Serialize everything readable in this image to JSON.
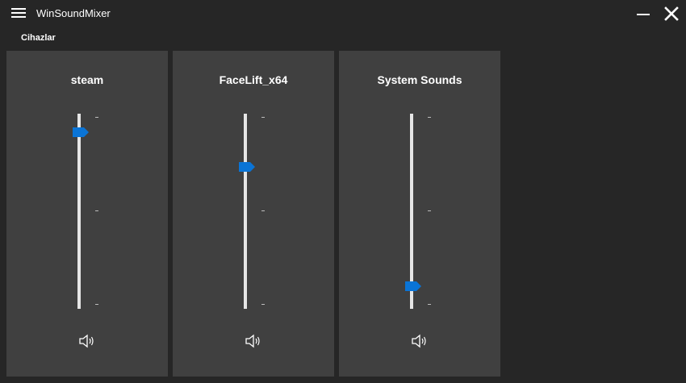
{
  "app": {
    "title": "WinSoundMixer",
    "devices_label": "Cihazlar"
  },
  "colors": {
    "window_bg": "#262626",
    "panel_bg": "#404040",
    "accent": "#0a74d6",
    "track": "#e6e6e6"
  },
  "icons": {
    "menu": "hamburger-menu-icon",
    "minimize": "minimize-icon",
    "close": "close-icon",
    "speaker": "speaker-icon"
  },
  "channels": [
    {
      "name": "steam",
      "volume": 0.91
    },
    {
      "name": "FaceLift_x64",
      "volume": 0.73
    },
    {
      "name": "System Sounds",
      "volume": 0.12
    }
  ]
}
